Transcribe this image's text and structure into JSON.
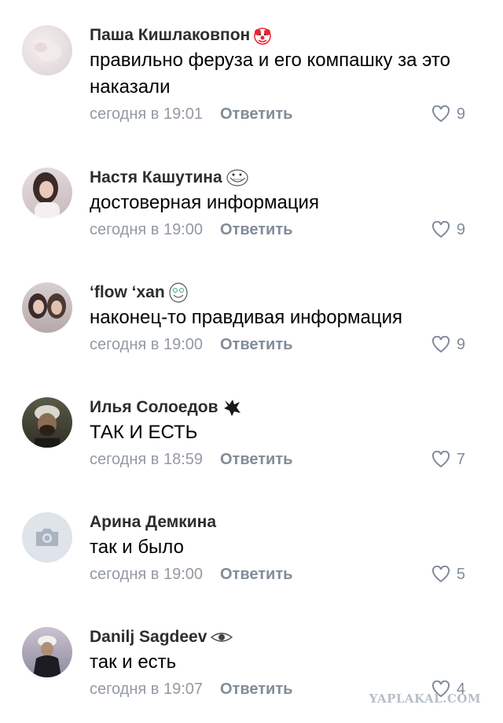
{
  "comments": [
    {
      "author": "Паша Кишлаковпон",
      "badge": "clown-icon",
      "text": "правильно феруза и его компашку за это наказали",
      "time": "сегодня в 19:01",
      "reply": "Ответить",
      "likes": "9"
    },
    {
      "author": "Настя Кашутина",
      "badge": "troll-face-icon",
      "text": "достоверная информация",
      "time": "сегодня в 19:00",
      "reply": "Ответить",
      "likes": "9"
    },
    {
      "author": "‘flow ‘xan",
      "badge": "troll-face-icon",
      "text": "наконец-то правдивая информация",
      "time": "сегодня в 19:00",
      "reply": "Ответить",
      "likes": "9"
    },
    {
      "author": "Илья Солоедов",
      "badge": "wolf-logo-icon",
      "text": "ТАК И ЕСТЬ",
      "time": "сегодня в 18:59",
      "reply": "Ответить",
      "likes": "7"
    },
    {
      "author": "Арина Демкина",
      "badge": "",
      "text": "так и было",
      "time": "сегодня в 19:00",
      "reply": "Ответить",
      "likes": "5"
    },
    {
      "author": "Danilj Sagdeev",
      "badge": "eye-icon",
      "text": "так и есть",
      "time": "сегодня в 19:07",
      "reply": "Ответить",
      "likes": "4"
    }
  ],
  "watermark": "YAPLAKAL.COM",
  "colors": {
    "secondary": "#818c99",
    "name": "#2c2d2e",
    "placeholder_avatar": "#dfe3ea"
  }
}
